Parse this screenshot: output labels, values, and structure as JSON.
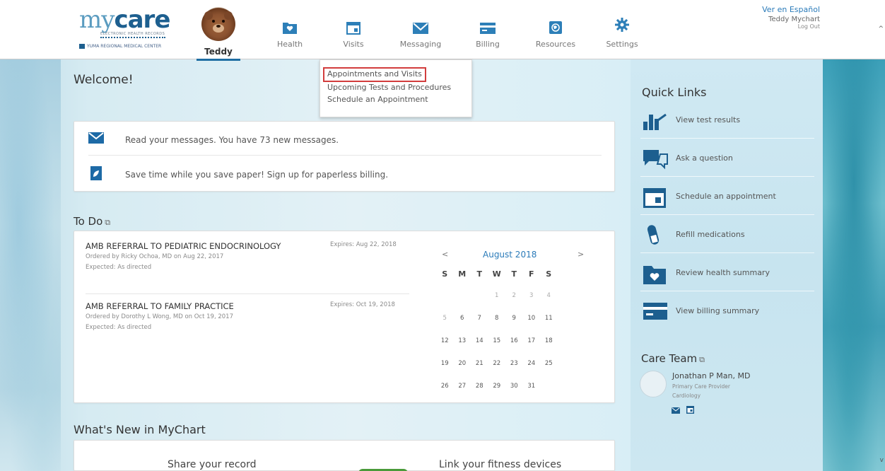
{
  "header": {
    "logo": {
      "my": "my",
      "care": "care",
      "subtitle": "ELECTRONIC HEALTH RECORDS",
      "org": "YUMA REGIONAL MEDICAL CENTER"
    },
    "nav": [
      {
        "label": "Teddy",
        "icon": "patient-avatar"
      },
      {
        "label": "Health",
        "icon": "folder-heart-icon"
      },
      {
        "label": "Visits",
        "icon": "calendar-icon"
      },
      {
        "label": "Messaging",
        "icon": "envelope-icon"
      },
      {
        "label": "Billing",
        "icon": "credit-card-icon"
      },
      {
        "label": "Resources",
        "icon": "globe-icon"
      },
      {
        "label": "Settings",
        "icon": "gear-icon"
      }
    ],
    "language_link": "Ver en Español",
    "user_name": "Teddy Mychart",
    "logout": "Log Out"
  },
  "dropdown": {
    "items": [
      "Appointments and Visits",
      "Upcoming Tests and Procedures",
      "Schedule an Appointment"
    ]
  },
  "welcome": {
    "title": "Welcome!",
    "messages": [
      {
        "icon": "envelope-icon",
        "text": "Read your messages. You have 73 new messages."
      },
      {
        "icon": "paperless-billing-icon",
        "text": "Save time while you save paper! Sign up for paperless billing."
      }
    ]
  },
  "todo": {
    "title": "To Do",
    "items": [
      {
        "name": "AMB REFERRAL TO PEDIATRIC ENDOCRINOLOGY",
        "ordered": "Ordered by Ricky Ochoa, MD on Aug 22, 2017",
        "expected": "Expected: As directed",
        "expires": "Expires: Aug 22, 2018"
      },
      {
        "name": "AMB REFERRAL TO FAMILY PRACTICE",
        "ordered": "Ordered by Dorothy L Wong, MD on Oct 19, 2017",
        "expected": "Expected: As directed",
        "expires": "Expires: Oct 19, 2018"
      }
    ],
    "calendar": {
      "month": "August 2018",
      "prev": "<",
      "next": ">",
      "weekdays": [
        "S",
        "M",
        "T",
        "W",
        "T",
        "F",
        "S"
      ],
      "weeks": [
        [
          "",
          "",
          "",
          "1",
          "2",
          "3",
          "4"
        ],
        [
          "5",
          "6",
          "7",
          "8",
          "9",
          "10",
          "11"
        ],
        [
          "12",
          "13",
          "14",
          "15",
          "16",
          "17",
          "18"
        ],
        [
          "19",
          "20",
          "21",
          "22",
          "23",
          "24",
          "25"
        ],
        [
          "26",
          "27",
          "28",
          "29",
          "30",
          "31",
          ""
        ]
      ]
    }
  },
  "whats_new": {
    "title": "What's New in MyChart",
    "items": [
      "Share your record",
      "Link your fitness devices"
    ]
  },
  "quick_links": {
    "title": "Quick Links",
    "items": [
      {
        "label": "View test results",
        "icon": "bar-chart-icon"
      },
      {
        "label": "Ask a question",
        "icon": "chat-bubbles-icon"
      },
      {
        "label": "Schedule an appointment",
        "icon": "calendar-icon"
      },
      {
        "label": "Refill medications",
        "icon": "pill-bottle-icon"
      },
      {
        "label": "Review health summary",
        "icon": "folder-heart-icon"
      },
      {
        "label": "View billing summary",
        "icon": "credit-card-icon"
      }
    ]
  },
  "care_team": {
    "title": "Care Team",
    "members": [
      {
        "name": "Jonathan P Man, MD",
        "role": "Primary Care Provider",
        "specialty": "Cardiology"
      }
    ]
  },
  "colors": {
    "brand_dark": "#1d5f8f",
    "brand_light": "#5b9cc0",
    "icon_blue": "#2d7fb8",
    "highlight_red": "#d23d3d"
  }
}
